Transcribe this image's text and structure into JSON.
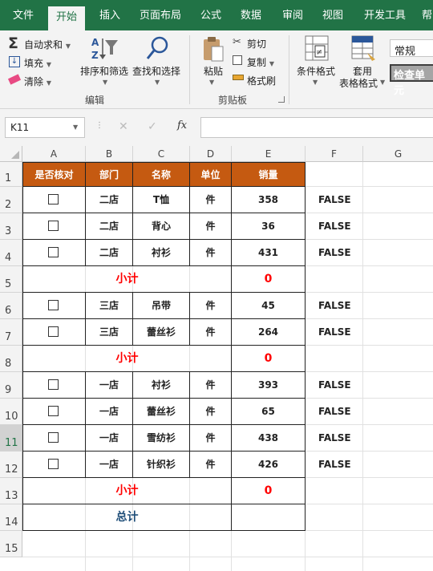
{
  "tabs": [
    "文件",
    "开始",
    "插入",
    "页面布局",
    "公式",
    "数据",
    "审阅",
    "视图",
    "开发工具",
    "帮"
  ],
  "ribbon": {
    "autosum": "自动求和",
    "fill": "填充",
    "clear": "清除",
    "sort_filter": "排序和筛选",
    "find_select": "查找和选择",
    "group_edit": "编辑",
    "paste": "粘贴",
    "cut": "剪切",
    "copy": "复制",
    "format_painter": "格式刷",
    "group_clipboard": "剪贴板",
    "cond_format_1": "条件格式",
    "table_format_1": "套用",
    "table_format_2": "表格格式",
    "number_format": "常规",
    "check_cell": "检查单元"
  },
  "formula_bar": {
    "name_box": "K11",
    "fx": "fx"
  },
  "columns": [
    "A",
    "B",
    "C",
    "D",
    "E",
    "F",
    "G"
  ],
  "rows": [
    "1",
    "2",
    "3",
    "4",
    "5",
    "6",
    "7",
    "8",
    "9",
    "10",
    "11",
    "12",
    "13",
    "14",
    "15"
  ],
  "header": [
    "是否核对",
    "部门",
    "名称",
    "单位",
    "销量"
  ],
  "data_rows": [
    {
      "dept": "二店",
      "name": "T恤",
      "unit": "件",
      "qty": "358",
      "f": "FALSE"
    },
    {
      "dept": "二店",
      "name": "背心",
      "unit": "件",
      "qty": "36",
      "f": "FALSE"
    },
    {
      "dept": "二店",
      "name": "衬衫",
      "unit": "件",
      "qty": "431",
      "f": "FALSE"
    },
    {
      "dept": "三店",
      "name": "吊带",
      "unit": "件",
      "qty": "45",
      "f": "FALSE"
    },
    {
      "dept": "三店",
      "name": "蕾丝衫",
      "unit": "件",
      "qty": "264",
      "f": "FALSE"
    },
    {
      "dept": "一店",
      "name": "衬衫",
      "unit": "件",
      "qty": "393",
      "f": "FALSE"
    },
    {
      "dept": "一店",
      "name": "蕾丝衫",
      "unit": "件",
      "qty": "65",
      "f": "FALSE"
    },
    {
      "dept": "一店",
      "name": "雪纺衫",
      "unit": "件",
      "qty": "438",
      "f": "FALSE"
    },
    {
      "dept": "一店",
      "name": "针织衫",
      "unit": "件",
      "qty": "426",
      "f": "FALSE"
    }
  ],
  "subtotal_label": "小计",
  "subtotal_value": "0",
  "total_label": "总计",
  "colors": {
    "ribbon_green": "#217346",
    "header_fill": "#c55a11",
    "subtotal_red": "#ff0000",
    "total_blue": "#1f4e79"
  }
}
